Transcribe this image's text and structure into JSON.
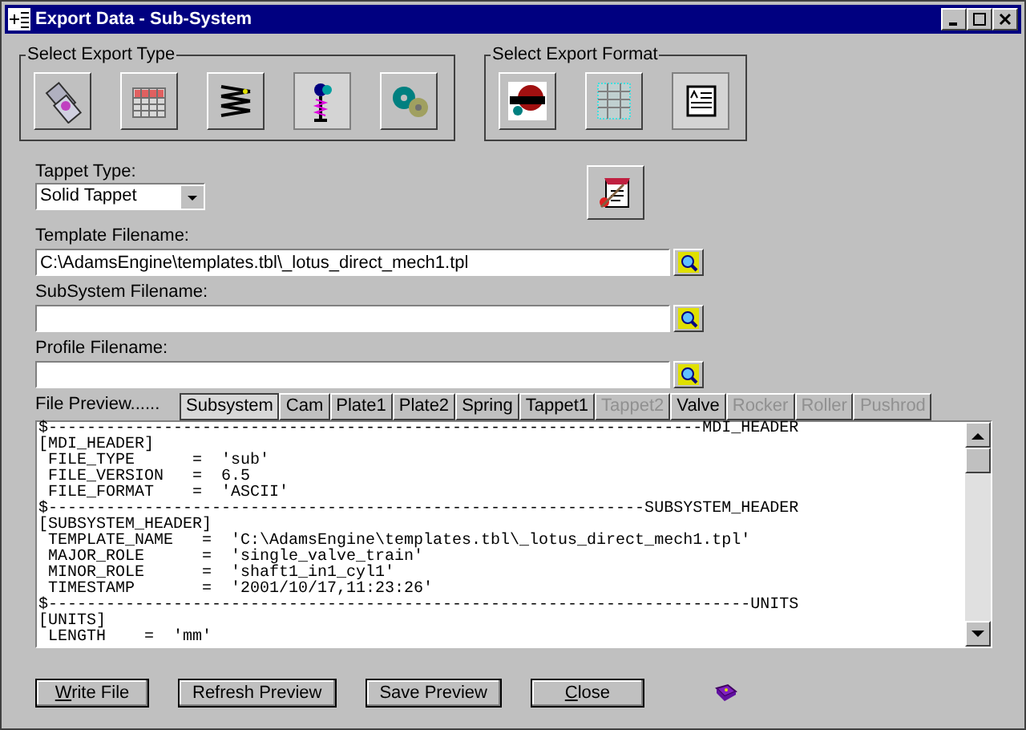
{
  "window": {
    "title": "Export Data - Sub-System"
  },
  "export_type": {
    "label": "Select Export Type",
    "buttons": [
      {
        "selected": false
      },
      {
        "selected": false
      },
      {
        "selected": false
      },
      {
        "selected": true
      },
      {
        "selected": false
      }
    ]
  },
  "export_format": {
    "label": "Select Export Format",
    "buttons": [
      {
        "selected": false
      },
      {
        "selected": false
      },
      {
        "selected": true
      }
    ]
  },
  "tappet_type": {
    "label": "Tappet Type:",
    "value": "Solid Tappet"
  },
  "fields": [
    {
      "label": "Template Filename:",
      "value": "C:\\AdamsEngine\\templates.tbl\\_lotus_direct_mech1.tpl"
    },
    {
      "label": "SubSystem Filename:"
    },
    {
      "label": "Profile Filename:"
    }
  ],
  "preview": {
    "label": "File Preview......",
    "tabs": [
      {
        "label": "Subsystem",
        "selected": true,
        "disabled": false
      },
      {
        "label": "Cam",
        "selected": false,
        "disabled": false
      },
      {
        "label": "Plate1",
        "selected": false,
        "disabled": false
      },
      {
        "label": "Plate2",
        "selected": false,
        "disabled": false
      },
      {
        "label": "Spring",
        "selected": false,
        "disabled": false
      },
      {
        "label": "Tappet1",
        "selected": false,
        "disabled": false
      },
      {
        "label": "Tappet2",
        "selected": false,
        "disabled": true
      },
      {
        "label": "Valve",
        "selected": false,
        "disabled": false
      },
      {
        "label": "Rocker",
        "selected": false,
        "disabled": true
      },
      {
        "label": "Roller",
        "selected": false,
        "disabled": true
      },
      {
        "label": "Pushrod",
        "selected": false,
        "disabled": true
      }
    ],
    "lines": [
      "$--------------------------------------------------------------------MDI_HEADER",
      "[MDI_HEADER]",
      " FILE_TYPE      =  'sub'",
      " FILE_VERSION   =  6.5",
      " FILE_FORMAT    =  'ASCII'",
      "$--------------------------------------------------------------SUBSYSTEM_HEADER",
      "[SUBSYSTEM_HEADER]",
      " TEMPLATE_NAME   =  'C:\\AdamsEngine\\templates.tbl\\_lotus_direct_mech1.tpl'",
      " MAJOR_ROLE      =  'single_valve_train'",
      " MINOR_ROLE      =  'shaft1_in1_cyl1'",
      " TIMESTAMP       =  '2001/10/17,11:23:26'",
      "$-------------------------------------------------------------------------UNITS",
      "[UNITS]",
      " LENGTH    =  'mm'"
    ]
  },
  "buttons": [
    {
      "label": "Write File",
      "underline_first": true
    },
    {
      "label": "Refresh Preview",
      "underline_first": false
    },
    {
      "label": "Save Preview",
      "underline_first": false
    },
    {
      "label": "Close",
      "underline_first": true
    }
  ]
}
